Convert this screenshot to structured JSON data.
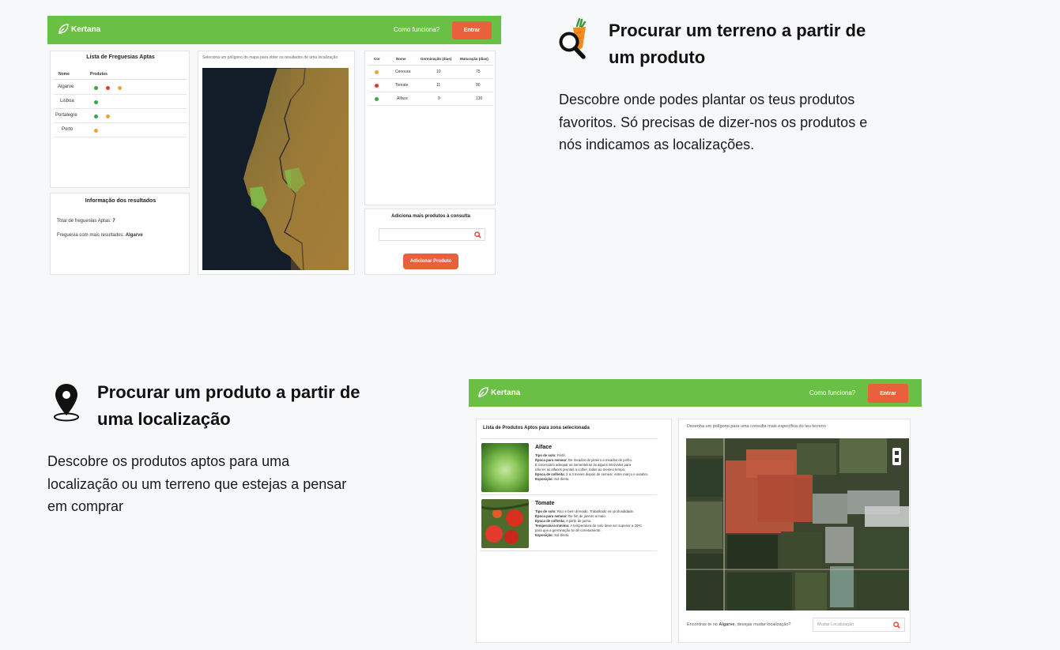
{
  "mock1": {
    "brand": "Kertana",
    "nav_link": "Como funciona?",
    "login": "Entrar",
    "list_title": "Lista de Freguesias Aptas",
    "list_col_name": "Nome",
    "list_col_products": "Produtos",
    "parishes": [
      {
        "name": "Algarve",
        "dots": [
          "#3aa648",
          "#e23b2e",
          "#f0a13a"
        ]
      },
      {
        "name": "Lisboa",
        "dots": [
          "#3aa648"
        ]
      },
      {
        "name": "Portalegre",
        "dots": [
          "#3aa648",
          "#f0a13a"
        ]
      },
      {
        "name": "Porto",
        "dots": [
          "#f0a13a"
        ]
      }
    ],
    "map_caption": "Seleciona um polígono do mapa para obter os resultados de uma localização",
    "results_title": "Informação dos resultados",
    "results_total_label": "Total de freguesias Aptas:",
    "results_total_value": "7",
    "results_best_label": "Freguesia com mais resultados:",
    "results_best_value": "Algarve",
    "table_headers": [
      "Cor",
      "Nome",
      "Germinação (dias)",
      "Maturação (dias)"
    ],
    "products": [
      {
        "color": "#f0a13a",
        "name": "Cenoura",
        "germ": "10",
        "mat": "75"
      },
      {
        "color": "#e23b2e",
        "name": "Tomate",
        "germ": "11",
        "mat": "90"
      },
      {
        "color": "#3aa648",
        "name": "Alface",
        "germ": "9",
        "mat": "130"
      }
    ],
    "add_title": "Adiciona mais produtos à consulta",
    "add_button": "Adicionar Produto"
  },
  "feature1": {
    "title_line1": "Procurar um terreno a partir de",
    "title_line2": "um produto",
    "desc_line1": "Descobre onde podes plantar os teus produtos",
    "desc_line2": "favoritos. Só precisas de dizer-nos os produtos e",
    "desc_line3": "nós indicamos as localizações."
  },
  "feature2": {
    "title_line1": "Procurar um produto a partir de",
    "title_line2": "uma localização",
    "desc_line1": "Descobre os produtos aptos para uma",
    "desc_line2": "localização ou um terreno que estejas a pensar",
    "desc_line3": "em comprar"
  },
  "mock2": {
    "brand": "Kertana",
    "nav_link": "Como funciona?",
    "login": "Entrar",
    "list_title": "Lista de Produtos Aptos para zona selecionada",
    "items": [
      {
        "name": "Alface",
        "l1_label": "Tipo de solo:",
        "l1_text": "Fértil.",
        "l2_label": "Época para semear:",
        "l2_text": "De meados de janeiro a meados de junho.",
        "l3_text": "É necessário adequar as sementeiras às alguns intervalos para",
        "l4_text": "não ter as alfaces prontas a colher, todas ao mesmo tempo.",
        "l5_label": "Época de colheita:",
        "l5_text": "2 a 3 meses depois de semear, entre março e outubro.",
        "l6_label": "Exposição:",
        "l6_text": "Sol direto."
      },
      {
        "name": "Tomate",
        "l1_label": "Tipo de solo:",
        "l1_text": "Rico e bem drenado. Trabalhado em profundidade.",
        "l2_label": "Época para semear:",
        "l2_text": "De fim de janeiro a maio.",
        "l3_label": "Época de colheita:",
        "l3_text": "A partir de junho.",
        "l4_label": "Temperatura mínima:",
        "l4_text": "A temperatura do solo deve ser superior a 20ºC",
        "l5_text": "para que a germinação se dê corretamente.",
        "l6_label": "Exposição:",
        "l6_text": "Sol direto."
      }
    ],
    "map_caption": "Desenha um polígono para uma consulta mais específica do teu terreno",
    "location_prefix": "Encontras-te no",
    "location_name": "Algarve",
    "location_suffix": ", desejas mudar localização?",
    "search_placeholder": "Mudar Localização"
  }
}
